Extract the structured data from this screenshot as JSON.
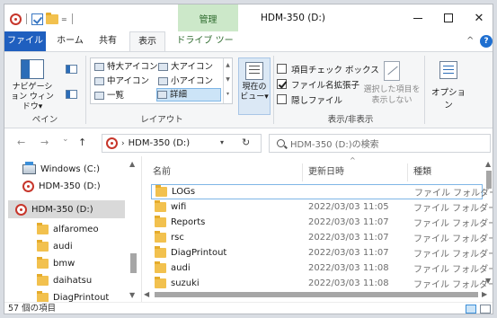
{
  "window": {
    "title": "HDM-350 (D:)",
    "context_tab": "管理",
    "minimize_glyph": "—",
    "maximize_glyph": "☐",
    "close_glyph": "✕"
  },
  "quick_access": {
    "dropdown": "="
  },
  "menu_tabs": {
    "file": "ファイル",
    "home": "ホーム",
    "share": "共有",
    "view": "表示",
    "drive_tools": "ドライブ ツール",
    "collapse": "^",
    "help": "?"
  },
  "ribbon": {
    "nav_pane_label": "ナビゲーション ウィンドウ▾",
    "pane_group": "ペイン",
    "layout_group": "レイアウト",
    "layout_items": {
      "extra_large": "特大アイコン",
      "large": "大アイコン",
      "medium": "中アイコン",
      "small": "小アイコン",
      "list": "一覧",
      "details": "詳細"
    },
    "current_view": "現在の ビュー▾",
    "checkboxes": [
      {
        "label": "項目チェック ボックス",
        "checked": false
      },
      {
        "label": "ファイル名拡張子",
        "checked": true
      },
      {
        "label": "隠しファイル",
        "checked": false
      }
    ],
    "hide_selected": "選択した項目を 表示しない",
    "show_hide_group": "表示/非表示",
    "options": "オプション"
  },
  "address": {
    "back": "←",
    "forward": "→",
    "recent": "⌄",
    "up": "↑",
    "path": "HDM-350 (D:)",
    "refresh": "↻",
    "search_placeholder": "HDM-350 (D:)の検索"
  },
  "nav_pane": {
    "items": [
      {
        "label": "Windows (C:)",
        "icon": "drive-icon"
      },
      {
        "label": "HDM-350 (D:)",
        "icon": "cd-drive-icon"
      },
      {
        "label": "HDM-350 (D:)",
        "icon": "cd-drive-icon",
        "selected": true
      },
      {
        "label": "alfaromeo",
        "icon": "folder-icon"
      },
      {
        "label": "audi",
        "icon": "folder-icon"
      },
      {
        "label": "bmw",
        "icon": "folder-icon"
      },
      {
        "label": "daihatsu",
        "icon": "folder-icon"
      },
      {
        "label": "DiagPrintout",
        "icon": "folder-icon"
      }
    ]
  },
  "file_list": {
    "columns": {
      "name": "名前",
      "modified": "更新日時",
      "type": "種類"
    },
    "rows": [
      {
        "name": "LOGs",
        "modified": "",
        "type": "ファイル フォルダー"
      },
      {
        "name": "wifi",
        "modified": "2022/03/03 11:05",
        "type": "ファイル フォルダー"
      },
      {
        "name": "Reports",
        "modified": "2022/03/03 11:07",
        "type": "ファイル フォルダー"
      },
      {
        "name": "rsc",
        "modified": "2022/03/03 11:07",
        "type": "ファイル フォルダー"
      },
      {
        "name": "DiagPrintout",
        "modified": "2022/03/03 11:07",
        "type": "ファイル フォルダー"
      },
      {
        "name": "audi",
        "modified": "2022/03/03 11:08",
        "type": "ファイル フォルダー"
      },
      {
        "name": "suzuki",
        "modified": "2022/03/03 11:08",
        "type": "ファイル フォルダー"
      }
    ]
  },
  "status": {
    "item_count": "57 個の項目"
  },
  "colors": {
    "accent": "#1f5fbf",
    "folder": "#f2c14e",
    "manage_tab": "#cce8c9"
  }
}
